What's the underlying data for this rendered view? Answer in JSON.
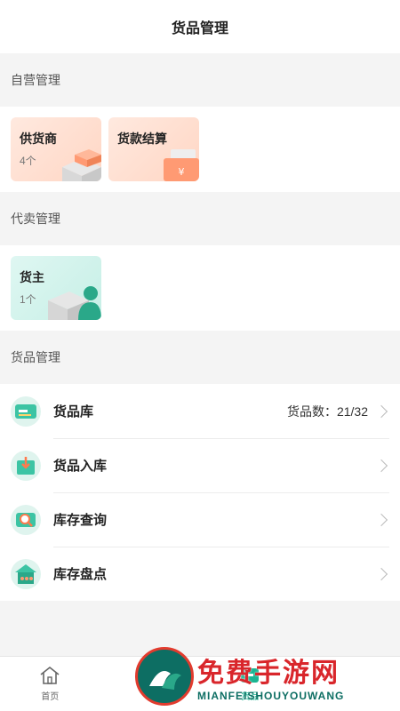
{
  "header": {
    "title": "货品管理"
  },
  "self_operated": {
    "title": "自营管理",
    "cards": [
      {
        "title": "供货商",
        "sub": "4个"
      },
      {
        "title": "货款结算",
        "sub": ""
      }
    ]
  },
  "consignment": {
    "title": "代卖管理",
    "cards": [
      {
        "title": "货主",
        "sub": "1个"
      }
    ]
  },
  "goods": {
    "title": "货品管理",
    "items": [
      {
        "label": "货品库",
        "count": "货品数：21/32"
      },
      {
        "label": "货品入库",
        "count": ""
      },
      {
        "label": "库存查询",
        "count": ""
      },
      {
        "label": "库存盘点",
        "count": ""
      }
    ]
  },
  "tabbar": {
    "tabs": [
      {
        "label": "首页",
        "icon": "home-icon"
      },
      {
        "label": "货品",
        "icon": "goods-icon"
      },
      {
        "label": "",
        "icon": ""
      },
      {
        "label": "",
        "icon": ""
      }
    ]
  },
  "watermark": {
    "main": "免费手游网",
    "sub": "MIANFEISHOUYOUWANG"
  },
  "colors": {
    "accent": "#19b592",
    "orange": "#ff8a5c",
    "teal": "#3cc4a4"
  }
}
